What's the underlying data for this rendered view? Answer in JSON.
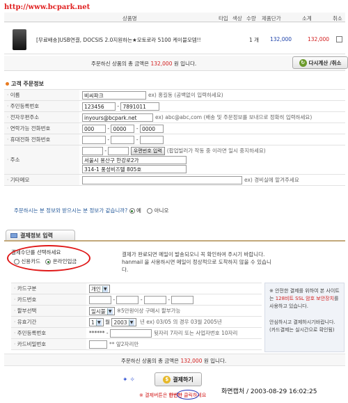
{
  "watermark": "http://www.bcpark.net",
  "cart": {
    "headers": {
      "product": "상품명",
      "type": "타입",
      "color": "색상",
      "qty": "수량",
      "unit_price": "제품단가",
      "subtotal": "소계",
      "cancel": "취소"
    },
    "item": {
      "name": "[무료배송]USB연결, DOCSIS 2.0지원하는★모토로라 5100 케이블모뎀!!",
      "qty": "1 개",
      "unit_price": "132,000",
      "subtotal": "132,000"
    },
    "total_prefix": "주문하신 상품의 총 금액은",
    "total_amount": "132,000",
    "total_suffix": "원 입니다.",
    "reselect_button": "다시계산 /취소"
  },
  "orderer": {
    "section_title": "고객 주문정보",
    "labels": {
      "name": "이름",
      "rrn": "주민등록번호",
      "email": "전자우편주소",
      "phone": "연락가능 전화번호",
      "mobile": "휴대전화 전화번호",
      "address": "주소",
      "memo": "기타메모"
    },
    "name_value": "비씨파크",
    "name_hint": "ex) 홍길동 (공백없이 입력하세요)",
    "rrn_1": "123456",
    "rrn_2": "7891011",
    "email_value": "inyours@bcpark.net",
    "email_hint": "ex) abc@abc,com (배송 및 주문정보를 보내므로 정확히 입력하세요)",
    "phone_1": "000",
    "phone_2": "0000",
    "phone_3": "0000",
    "zip_button": "우편번호 입력",
    "zip_hint": "(팝업빌러가 작동 중 이라면 일시 중지하세요)",
    "address_1": "서울시 용산구 한강로2가",
    "address_2": "314-1 풍성비즈텔 805호",
    "memo_hint": "ex) 경비실에 맡겨주세요",
    "same_question": "주문하시는 분 정보와 받으시는 분 정보가 같습니까?",
    "same_yes": "예",
    "same_no": "아니오"
  },
  "payment": {
    "tab_label": "결제정보 입력",
    "method_prompt": "결제수단를 선택하세요",
    "method_card": "신용카드",
    "method_online": "온라인입금",
    "notice_1": "결제가 완료되면 메일이 발송되오니 꼭 확인하여 주시기 바랍니다.",
    "notice_2": "hanmail 을 사용하시면 메일이 정상적으로 도착하지 않을 수 있습니다.",
    "labels": {
      "card_type": "카드구분",
      "card_no": "카드번호",
      "installment": "할부선택",
      "expiry": "유효기간",
      "rrn": "주민등록번호",
      "password": "카드비밀번호"
    },
    "card_type_value": "개인",
    "installment_value": "일시불",
    "installment_hint": "※5만원이상 구매시 할부가능",
    "expiry_month": "1",
    "expiry_month_unit": "월",
    "expiry_year": "2003",
    "expiry_hint": "년 ex) 03/05 의 경우 03월 2005년",
    "rrn_mask": "******",
    "rrn_hint": "뒷자리 7자리 또는 사업자번호 10자리",
    "pw_hint": "** 앞2자리만",
    "side_notice_1": "※ 안전한 결제를 위하여 본 사이트는",
    "side_notice_red": "128비트 SSL 암호 보안장치",
    "side_notice_2": "를 사용하고 있습니다.",
    "side_notice_3": "안심하시고 결제하시기바랍니다. (카드결제는 실시간으로 확인됨)",
    "total_prefix": "주문하신 상품의 총 금액은",
    "total_amount": "132,000",
    "total_suffix": "원 입니다.",
    "pay_button": "결제하기",
    "pay_warning_1": "※ 결제버튼은",
    "pay_warning_circle": "한번만",
    "pay_warning_2": "클릭하세요"
  },
  "capture_stamp": "화면캡처 / 2003-08-29 16:02:25",
  "colors": {
    "accent_red": "#d21d1d",
    "highlight_circle": "#e01818",
    "price_blue": "#1a3fa8"
  }
}
